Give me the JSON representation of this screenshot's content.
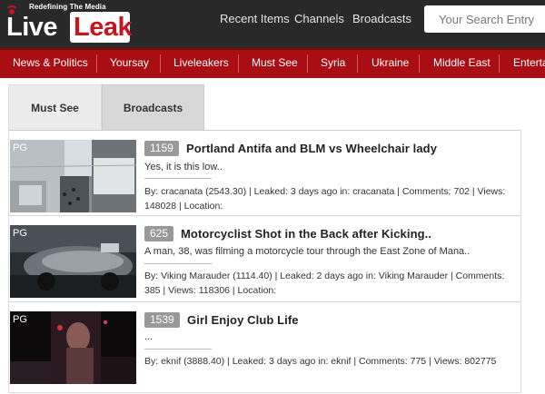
{
  "header": {
    "logo": {
      "tagline": "Redefining The Media",
      "word1": "Live",
      "word2": "Leak"
    },
    "nav": [
      "Recent Items",
      "Channels",
      "Broadcasts"
    ],
    "search_placeholder": "Your Search Entry"
  },
  "categories": [
    "News & Politics",
    "Yoursay",
    "Liveleakers",
    "Must See",
    "Syria",
    "Ukraine",
    "Middle East",
    "Enterta"
  ],
  "tabs": [
    "Must See",
    "Broadcasts"
  ],
  "items": [
    {
      "rating": "PG",
      "views_badge": "1159",
      "title": "Portland Antifa and BLM vs Wheelchair lady",
      "description": "Yes, it is this low..",
      "meta_line1": "By: cracanata (2543.30) | Leaked: 3 days ago in: cracanata | Comments: 702 | Views:",
      "meta_line2": "148028 | Location:"
    },
    {
      "rating": "PG",
      "views_badge": "625",
      "title": "Motorcyclist Shot in the Back after Kicking..",
      "description": "A man, 38, was filming a motorcycle tour through the East Zone of Mana..",
      "meta_line1": "By: Viking Marauder (1114.40) | Leaked: 2 days ago in: Viking Marauder | Comments:",
      "meta_line2": "385 | Views: 118306 | Location:"
    },
    {
      "rating": "PG",
      "views_badge": "1539",
      "title": "Girl Enjoy Club Life",
      "description": "...",
      "meta_line1": "By: eknif (3888.40) | Leaked: 3 days ago in: eknif | Comments: 775 | Views: 802775",
      "meta_line2": ""
    }
  ],
  "colors": {
    "topbar": "#292929",
    "accent_red": "#a90e14",
    "badge_grey": "#999999"
  }
}
